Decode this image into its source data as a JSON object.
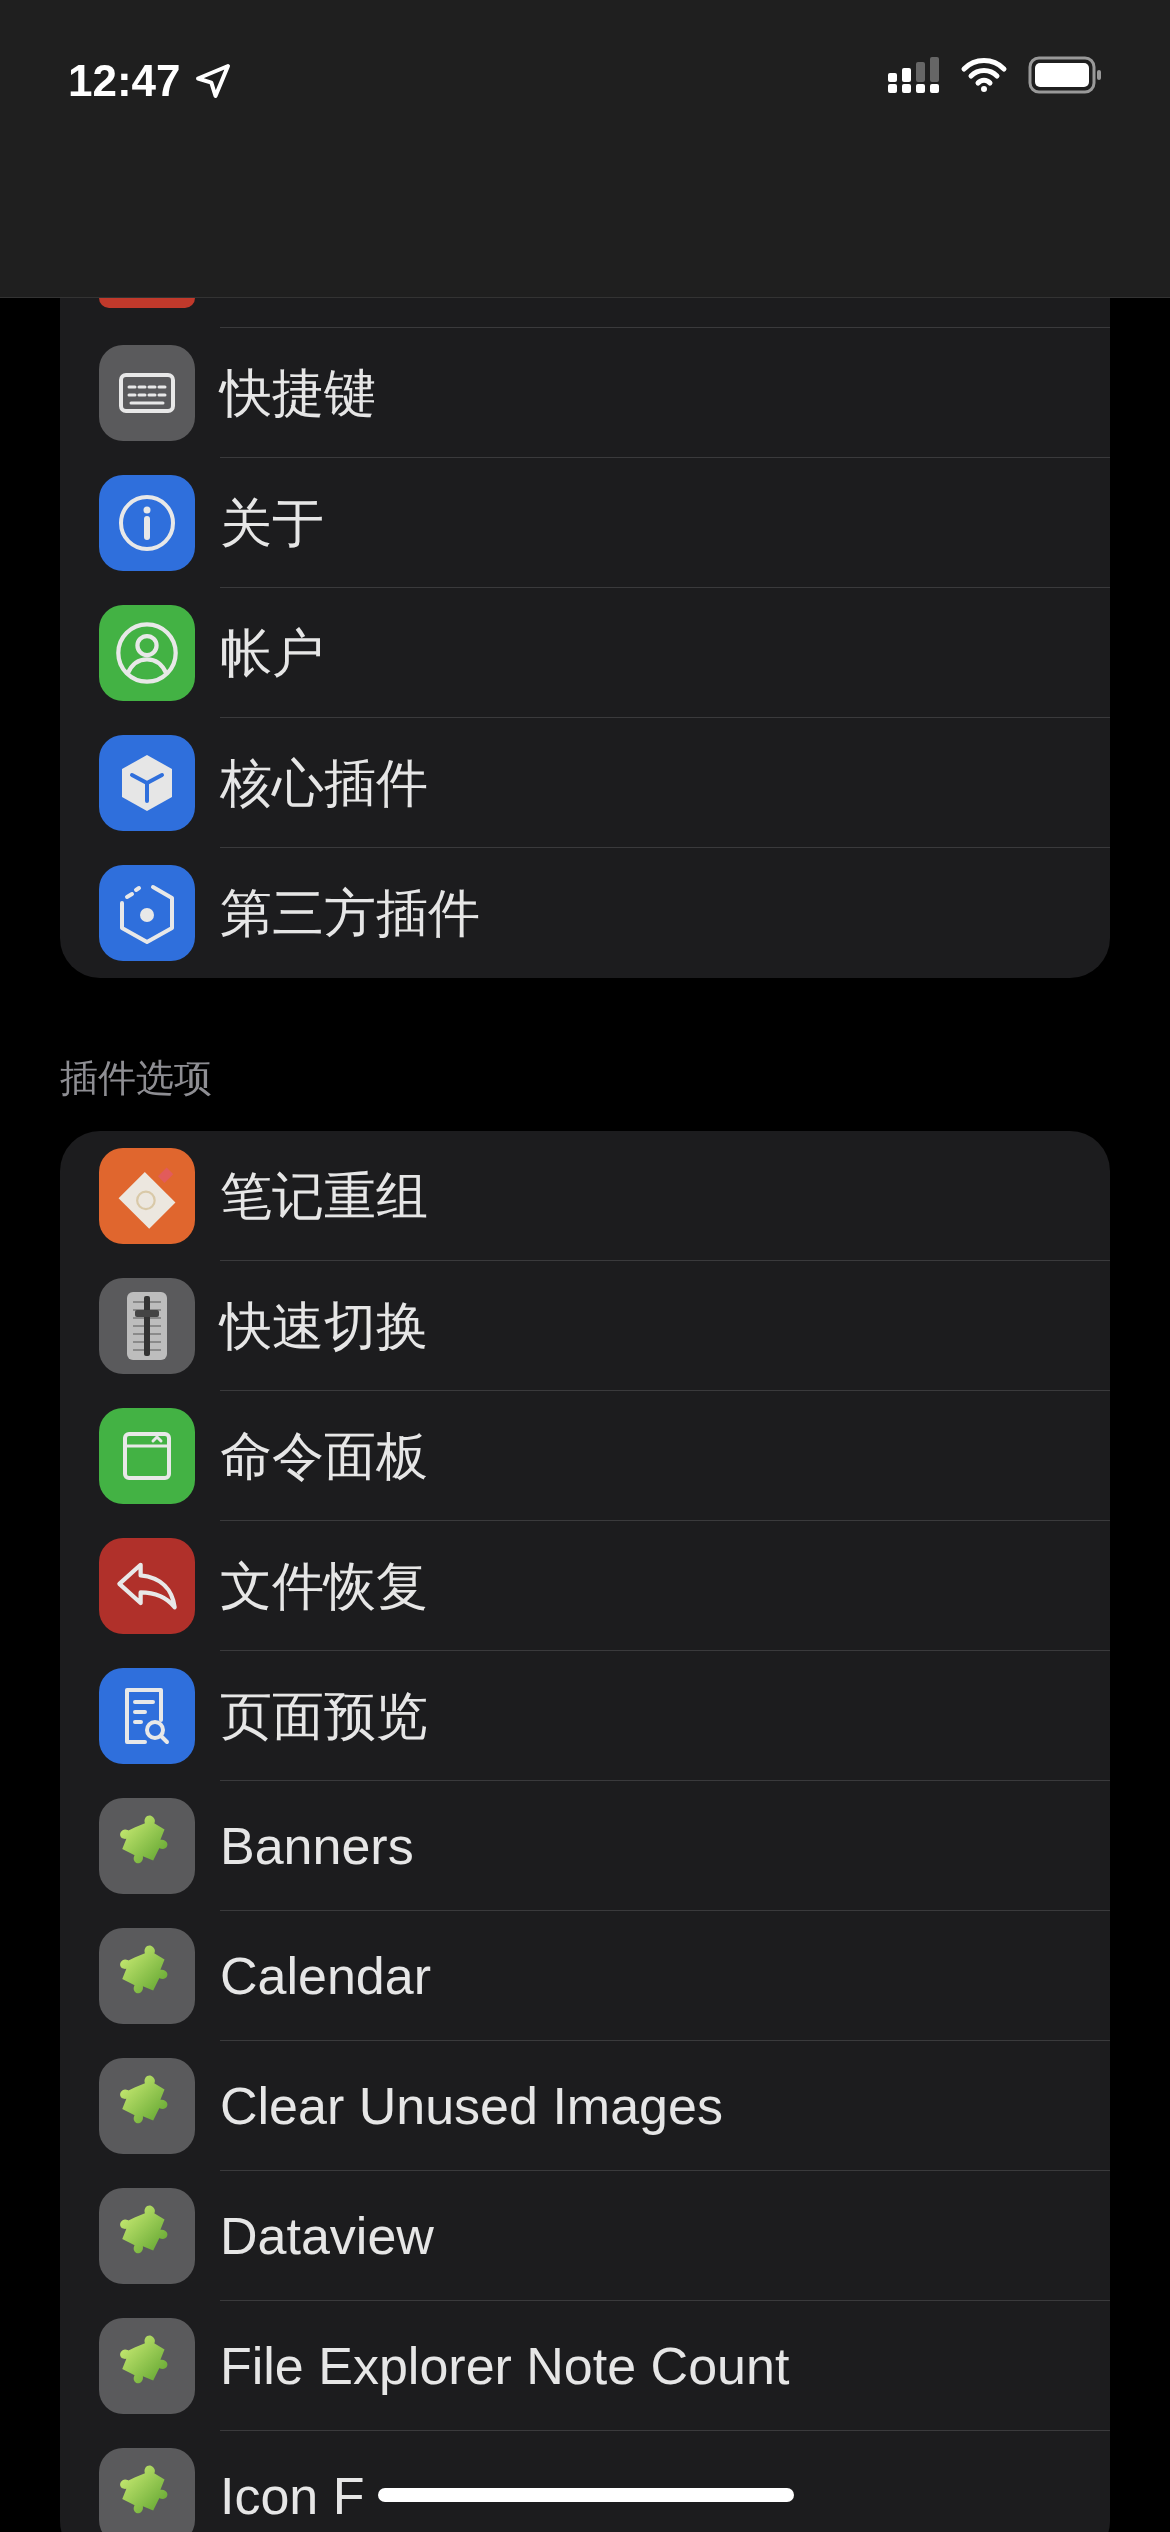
{
  "status_bar": {
    "time": "12:47"
  },
  "sections": [
    {
      "items": [
        {
          "label": "快捷键",
          "kind": "keyboard",
          "color": "#5a5a5c"
        },
        {
          "label": "关于",
          "kind": "info",
          "color": "#2f6fdc"
        },
        {
          "label": "帐户",
          "kind": "account",
          "color": "#43b244"
        },
        {
          "label": "核心插件",
          "kind": "cube",
          "color": "#2f6fdc"
        },
        {
          "label": "第三方插件",
          "kind": "hexagon",
          "color": "#2f6fdc"
        }
      ]
    },
    {
      "header": "插件选项",
      "items": [
        {
          "label": "笔记重组",
          "kind": "card",
          "color": "#e0662e"
        },
        {
          "label": "快速切换",
          "kind": "fader",
          "color": "#5a5a5c"
        },
        {
          "label": "命令面板",
          "kind": "window",
          "color": "#43b244"
        },
        {
          "label": "文件恢复",
          "kind": "reply",
          "color": "#b0302a"
        },
        {
          "label": "页面预览",
          "kind": "document",
          "color": "#2f6fdc"
        },
        {
          "label": "Banners",
          "kind": "puzzle",
          "color": "#5a5a5c"
        },
        {
          "label": "Calendar",
          "kind": "puzzle",
          "color": "#5a5a5c"
        },
        {
          "label": "Clear Unused Images",
          "kind": "puzzle",
          "color": "#5a5a5c"
        },
        {
          "label": "Dataview",
          "kind": "puzzle",
          "color": "#5a5a5c"
        },
        {
          "label": "File Explorer Note Count",
          "kind": "puzzle",
          "color": "#5a5a5c"
        },
        {
          "label": "Icon F",
          "kind": "puzzle",
          "color": "#5a5a5c"
        }
      ]
    }
  ]
}
